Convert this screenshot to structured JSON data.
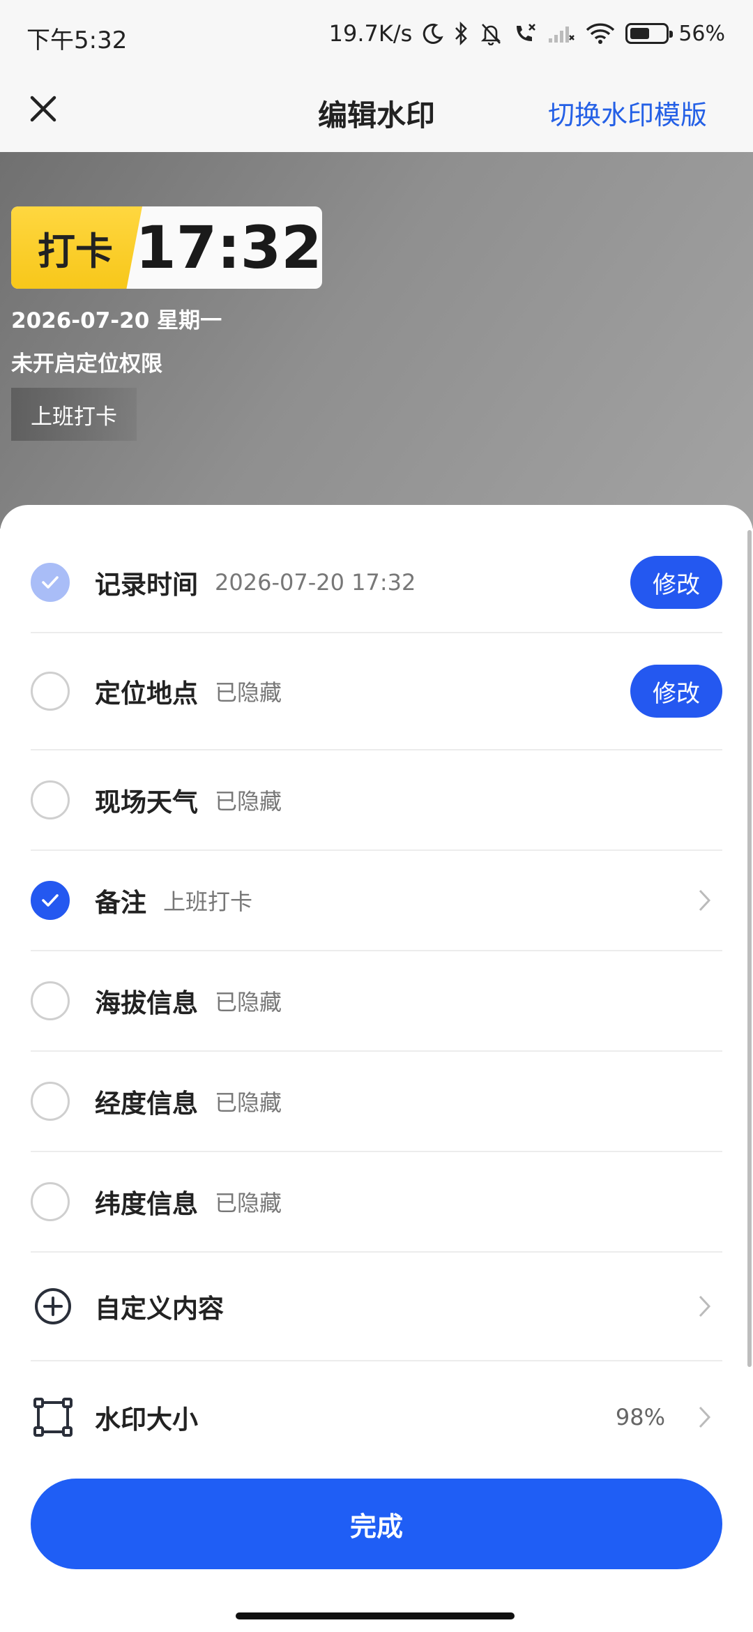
{
  "status_bar": {
    "time": "下午5:32",
    "net_speed": "19.7K/s",
    "battery_percent": "56%",
    "battery_level": 0.56,
    "icons": [
      "moon-icon",
      "bluetooth-icon",
      "mute-bell-icon",
      "call-icon",
      "signal-icon",
      "wifi-icon",
      "battery-icon"
    ]
  },
  "nav": {
    "title": "编辑水印",
    "switch_label": "切换水印模版",
    "close_icon": "close-icon"
  },
  "watermark": {
    "tag": "打卡",
    "time": "17:32",
    "date": "2026-07-20 星期一",
    "location": "未开启定位权限",
    "note": "上班打卡",
    "tag_color": "#f7c71a"
  },
  "options": [
    {
      "label": "记录时间",
      "value": "2026-07-20 17:32",
      "checked": true,
      "locked": true,
      "action": "修改"
    },
    {
      "label": "定位地点",
      "value": "已隐藏",
      "checked": false,
      "action": "修改"
    },
    {
      "label": "现场天气",
      "value": "已隐藏",
      "checked": false
    },
    {
      "label": "备注",
      "value": "上班打卡",
      "checked": true,
      "chevron": true
    },
    {
      "label": "海拔信息",
      "value": "已隐藏",
      "checked": false
    },
    {
      "label": "经度信息",
      "value": "已隐藏",
      "checked": false
    },
    {
      "label": "纬度信息",
      "value": "已隐藏",
      "checked": false
    }
  ],
  "custom_content": {
    "label": "自定义内容",
    "icon": "plus-circle-icon"
  },
  "watermark_size": {
    "label": "水印大小",
    "value": "98%",
    "icon": "resize-frame-icon"
  },
  "done_label": "完成",
  "accent_color": "#2458f0"
}
